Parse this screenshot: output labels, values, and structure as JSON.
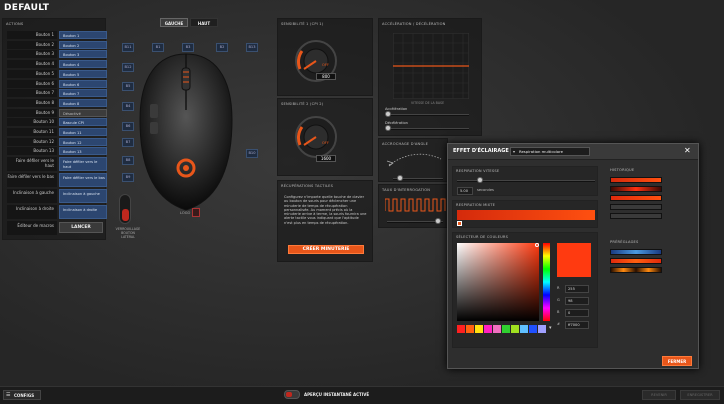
{
  "window": {
    "title": "DEFAULT"
  },
  "actions": {
    "header": "ACTIONS",
    "rows": [
      {
        "label": "Bouton 1",
        "value": "Bouton 1"
      },
      {
        "label": "Bouton 2",
        "value": "Bouton 2"
      },
      {
        "label": "Bouton 3",
        "value": "Bouton 3"
      },
      {
        "label": "Bouton 4",
        "value": "Bouton 4"
      },
      {
        "label": "Bouton 5",
        "value": "Bouton 5"
      },
      {
        "label": "Bouton 6",
        "value": "Bouton 6"
      },
      {
        "label": "Bouton 7",
        "value": "Bouton 7"
      },
      {
        "label": "Bouton 8",
        "value": "Bouton 8"
      },
      {
        "label": "Bouton 9",
        "value": "Désactivé"
      },
      {
        "label": "Bouton 10",
        "value": "Bascule CPI"
      },
      {
        "label": "Bouton 11",
        "value": "Bouton 11"
      },
      {
        "label": "Bouton 12",
        "value": "Bouton 12"
      },
      {
        "label": "Bouton 13",
        "value": "Bouton 13"
      }
    ],
    "tall_rows": [
      {
        "label": "Faire défiler vers le haut",
        "value": "Faire défiler vers le haut"
      },
      {
        "label": "Faire défiler vers le bas",
        "value": "Faire défiler vers le bas"
      },
      {
        "label": "Inclinaison à gauche",
        "value": "Inclinaison à gauche"
      },
      {
        "label": "Inclinaison à droite",
        "value": "Inclinaison à droite"
      }
    ],
    "macro_label": "Éditeur de macros",
    "launch_label": "LANCER"
  },
  "mouse_view": {
    "tabs": [
      "GAUCHE",
      "HAUT"
    ],
    "buttons": [
      "B11",
      "B1",
      "B3",
      "B2",
      "B13",
      "B12",
      "B5",
      "B4",
      "B6",
      "B7",
      "B8",
      "B9",
      "B10"
    ],
    "logo_label": "LOGO",
    "lock_label": "VERROUILLAGE BOUTON LATÉRAL"
  },
  "sensitivity1": {
    "header": "SENSIBILITÉ 1 (CPI 1)",
    "value": "800",
    "off": "OFF"
  },
  "sensitivity2": {
    "header": "SENSIBILITÉ 2 (CPI 2)",
    "value": "1600",
    "off": "OFF"
  },
  "tactile": {
    "header": "RÉCUPÉRATIONS TACTILES",
    "description": "Configurez n'importe quelle touche de clavier ou bouton de souris pour déclencher une minuterie de temps de récupération personnalisée. Au moment précis où la minuterie arrive à terme, la souris fournira une alerte tactile vous indiquant que l'aptitude n'est plus en temps de récupération.",
    "button": "CRÉER MINUTERIE"
  },
  "accel": {
    "header": "ACCÉLÉRATION / DÉCÉLÉRATION",
    "axis_label": "VITESSE DE LA BASE",
    "accel_label": "Accélération",
    "decel_label": "Décélération"
  },
  "angle": {
    "header": "ACCROCHAGE D'ANGLE"
  },
  "polling": {
    "header": "TAUX D'INTERROGATION"
  },
  "lighting": {
    "header": "EFFET D'ÉCLAIRAGE",
    "effect": "Respiration multicolore",
    "speed_header": "RESPIRATION VITESSE",
    "speed_value": "5.00",
    "speed_unit": "secondes",
    "mode_header": "RESPIRATION MIXTE",
    "picker_header": "SÉLECTEUR DE COULEURS",
    "hex_label": "#",
    "r": "255",
    "g": "98",
    "b": "0",
    "hex": "ff7000",
    "history_header": "HISTORIQUE",
    "presets_header": "PRÉRÉGLAGES",
    "close_button": "FERMER"
  },
  "footer": {
    "configs": "CONFIGS",
    "preview": "APERÇU INSTANTANÉ ACTIVÉ",
    "revert": "REVENIR",
    "save": "ENREGISTRER"
  },
  "colors": {
    "accent": "#e8561a",
    "button_blue": "#2c4670",
    "dialog_bg": "#2e2e2e"
  }
}
